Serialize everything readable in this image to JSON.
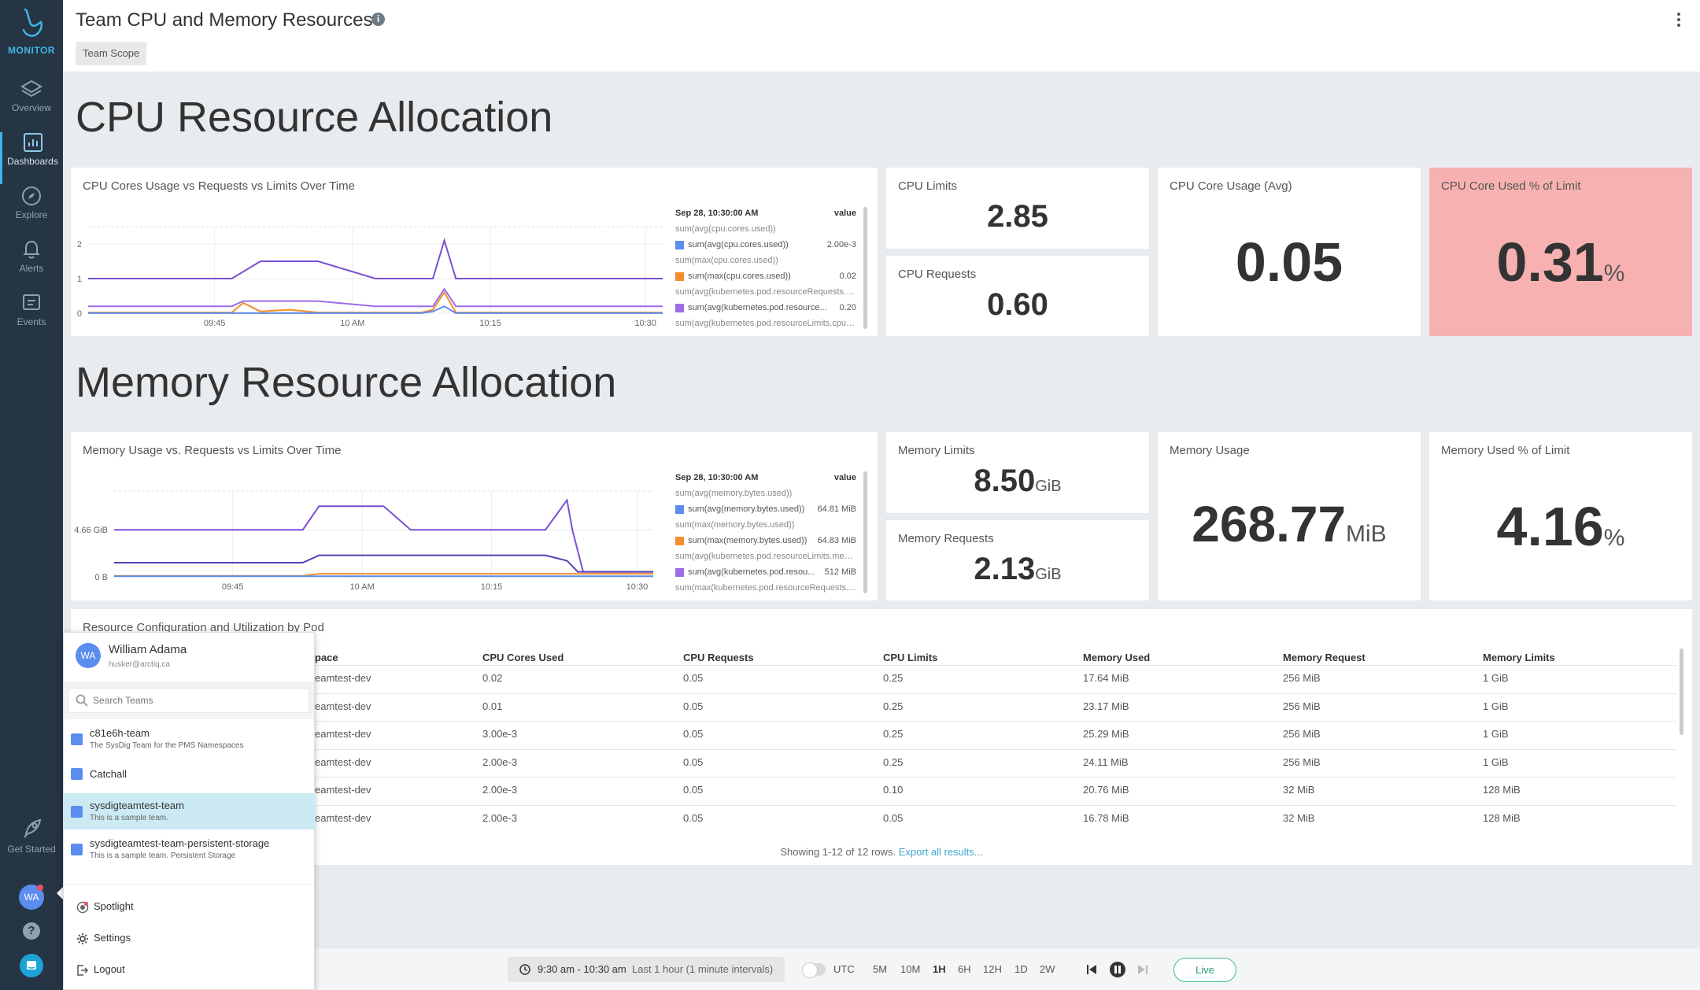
{
  "sidebar": {
    "logo_text": "MONITOR",
    "items": [
      {
        "label": "Overview"
      },
      {
        "label": "Dashboards"
      },
      {
        "label": "Explore"
      },
      {
        "label": "Alerts"
      },
      {
        "label": "Events"
      }
    ],
    "get_started": "Get Started",
    "avatar_initials": "WA",
    "accent": "#3fb5e6"
  },
  "header": {
    "title": "Team CPU and Memory Resources",
    "scope_chip": "Team Scope"
  },
  "cpu_section": {
    "heading": "CPU Resource Allocation",
    "chart_panel": {
      "title": "CPU Cores Usage vs Requests vs Limits Over Time",
      "legend_header": {
        "time": "Sep 28, 10:30:00 AM",
        "value_label": "value"
      },
      "legend": [
        {
          "name": "sum(avg(cpu.cores.used))",
          "value": "",
          "color": ""
        },
        {
          "name": "sum(avg(cpu.cores.used))",
          "value": "2.00e-3",
          "color": "#5b8def"
        },
        {
          "name": "sum(max(cpu.cores.used))",
          "value": "",
          "color": ""
        },
        {
          "name": "sum(max(cpu.cores.used))",
          "value": "0.02",
          "color": "#f28f2c"
        },
        {
          "name": "sum(avg(kubernetes.pod.resourceRequests.cp...",
          "value": "",
          "color": ""
        },
        {
          "name": "sum(avg(kubernetes.pod.resource...",
          "value": "0.20",
          "color": "#9b6ee8"
        },
        {
          "name": "sum(avg(kubernetes.pod.resourceLimits.cpuC...",
          "value": "",
          "color": ""
        }
      ]
    },
    "cpu_limits": {
      "title": "CPU Limits",
      "value": "2.85"
    },
    "cpu_requests": {
      "title": "CPU Requests",
      "value": "0.60"
    },
    "cpu_usage": {
      "title": "CPU Core Usage (Avg)",
      "value": "0.05"
    },
    "cpu_pct": {
      "title": "CPU Core Used % of Limit",
      "value": "0.31",
      "unit": "%"
    }
  },
  "memory_section": {
    "heading": "Memory Resource Allocation",
    "chart_panel": {
      "title": "Memory Usage vs. Requests vs Limits Over Time",
      "legend_header": {
        "time": "Sep 28, 10:30:00 AM",
        "value_label": "value"
      },
      "legend": [
        {
          "name": "sum(avg(memory.bytes.used))",
          "value": "",
          "color": ""
        },
        {
          "name": "sum(avg(memory.bytes.used))",
          "value": "64.81 MiB",
          "color": "#5b8def"
        },
        {
          "name": "sum(max(memory.bytes.used))",
          "value": "",
          "color": ""
        },
        {
          "name": "sum(max(memory.bytes.used))",
          "value": "64.83 MiB",
          "color": "#f28f2c"
        },
        {
          "name": "sum(avg(kubernetes.pod.resourceLimits.mem...",
          "value": "",
          "color": ""
        },
        {
          "name": "sum(avg(kubernetes.pod.resou...",
          "value": "512 MiB",
          "color": "#9b6ee8"
        },
        {
          "name": "sum(max(kubernetes.pod.resourceRequests....",
          "value": "",
          "color": ""
        }
      ]
    },
    "mem_limits": {
      "title": "Memory Limits",
      "value": "8.50",
      "unit": "GiB"
    },
    "mem_requests": {
      "title": "Memory Requests",
      "value": "2.13",
      "unit": "GiB"
    },
    "mem_usage": {
      "title": "Memory Usage",
      "value": "268.77",
      "unit": "MiB"
    },
    "mem_pct": {
      "title": "Memory Used % of Limit",
      "value": "4.16",
      "unit": "%"
    }
  },
  "chart_data": [
    {
      "type": "line",
      "x_ticks": [
        "09:45",
        "10 AM",
        "10:15",
        "10:30"
      ],
      "y_ticks": [
        "2",
        "1",
        "0"
      ],
      "ylim": [
        0,
        2.5
      ],
      "grid": true,
      "legend_placement": "right",
      "series": [
        {
          "name": "sum(avg(kubernetes.pod.resourceLimits.cpuC...",
          "color": "#7b4fd4",
          "x": [
            0,
            10,
            20,
            25,
            30,
            40,
            50,
            58,
            60,
            62,
            64,
            70,
            80,
            90,
            100
          ],
          "values": [
            1.0,
            1.0,
            1.0,
            1.0,
            1.5,
            1.5,
            1.0,
            1.0,
            1.0,
            2.1,
            1.0,
            1.0,
            1.0,
            1.0,
            1.0
          ]
        },
        {
          "name": "sum(avg(kubernetes.pod.resource...",
          "color": "#9b6ee8",
          "x": [
            0,
            25,
            27,
            40,
            50,
            58,
            60,
            62,
            64,
            80,
            100
          ],
          "values": [
            0.2,
            0.2,
            0.35,
            0.35,
            0.2,
            0.2,
            0.2,
            0.7,
            0.2,
            0.2,
            0.2
          ]
        },
        {
          "name": "sum(max(cpu.cores.used))",
          "color": "#f28f2c",
          "x": [
            0,
            25,
            27,
            30,
            35,
            40,
            58,
            60,
            62,
            64,
            100
          ],
          "values": [
            0.02,
            0.02,
            0.3,
            0.05,
            0.1,
            0.02,
            0.02,
            0.1,
            0.6,
            0.02,
            0.02
          ]
        },
        {
          "name": "sum(avg(cpu.cores.used))",
          "color": "#5b8def",
          "x": [
            0,
            58,
            60,
            62,
            64,
            100
          ],
          "values": [
            0.002,
            0.002,
            0.05,
            0.2,
            0.002,
            0.002
          ]
        }
      ]
    },
    {
      "type": "line",
      "x_ticks": [
        "09:45",
        "10 AM",
        "10:15",
        "10:30"
      ],
      "y_ticks": [
        "4.66 GiB",
        "0 B"
      ],
      "ylim": [
        0,
        8.5
      ],
      "grid": true,
      "legend_placement": "right",
      "series": [
        {
          "name": "sum(avg(kubernetes.pod.resourceLimits.mem...",
          "color": "#7b4fd4",
          "x": [
            0,
            35,
            38,
            50,
            55,
            80,
            84,
            85,
            87,
            100
          ],
          "values": [
            4.66,
            4.66,
            7.0,
            7.0,
            4.66,
            4.66,
            7.6,
            4.66,
            0.5,
            0.5
          ]
        },
        {
          "name": "sum(avg(kubernetes.pod.resou...",
          "color": "#5b3fb8",
          "x": [
            0,
            35,
            38,
            80,
            84,
            86,
            100
          ],
          "values": [
            1.4,
            1.4,
            2.13,
            2.13,
            1.6,
            0.5,
            0.5
          ]
        },
        {
          "name": "sum(max(memory.bytes.used))",
          "color": "#f28f2c",
          "x": [
            0,
            35,
            38,
            100
          ],
          "values": [
            0.1,
            0.1,
            0.3,
            0.3
          ]
        },
        {
          "name": "sum(avg(memory.bytes.used))",
          "color": "#5b8def",
          "x": [
            0,
            100
          ],
          "values": [
            0.06,
            0.06
          ]
        }
      ]
    }
  ],
  "table": {
    "title": "Resource Configuration and Utilization by Pod",
    "columns": [
      "pace",
      "CPU Cores Used",
      "CPU Requests",
      "CPU Limits",
      "Memory Used",
      "Memory Request",
      "Memory Limits"
    ],
    "rows": [
      [
        "eamtest-dev",
        "0.02",
        "0.05",
        "0.25",
        "17.64 MiB",
        "256 MiB",
        "1 GiB"
      ],
      [
        "eamtest-dev",
        "0.01",
        "0.05",
        "0.25",
        "23.17 MiB",
        "256 MiB",
        "1 GiB"
      ],
      [
        "eamtest-dev",
        "3.00e-3",
        "0.05",
        "0.25",
        "25.29 MiB",
        "256 MiB",
        "1 GiB"
      ],
      [
        "eamtest-dev",
        "2.00e-3",
        "0.05",
        "0.25",
        "24.11 MiB",
        "256 MiB",
        "1 GiB"
      ],
      [
        "eamtest-dev",
        "2.00e-3",
        "0.05",
        "0.10",
        "20.76 MiB",
        "32 MiB",
        "128 MiB"
      ],
      [
        "eamtest-dev",
        "2.00e-3",
        "0.05",
        "0.05",
        "16.78 MiB",
        "32 MiB",
        "128 MiB"
      ]
    ],
    "footer_text": "Showing 1-12 of 12 rows.",
    "footer_link": "Export all results..."
  },
  "team_popup": {
    "user_name": "William Adama",
    "user_email": "husker@arctiq.ca",
    "avatar_initials": "WA",
    "search_placeholder": "Search Teams",
    "teams": [
      {
        "name": "c81e6h-team",
        "desc": "The SysDig Team for the PMS Namespaces"
      },
      {
        "name": "Catchall",
        "desc": ""
      },
      {
        "name": "sysdigteamtest-team",
        "desc": "This is a sample team."
      },
      {
        "name": "sysdigteamtest-team-persistent-storage",
        "desc": "This is a sample team. Persistent Storage"
      }
    ],
    "selected_team": "sysdigteamtest-team",
    "menu": [
      "Spotlight",
      "Settings",
      "Logout"
    ]
  },
  "timebar": {
    "range": "9:30 am - 10:30 am",
    "range_desc": "Last 1 hour (1 minute intervals)",
    "utc_label": "UTC",
    "intervals": [
      "5M",
      "10M",
      "1H",
      "6H",
      "12H",
      "1D",
      "2W"
    ],
    "selected_interval": "1H",
    "live_label": "Live"
  }
}
